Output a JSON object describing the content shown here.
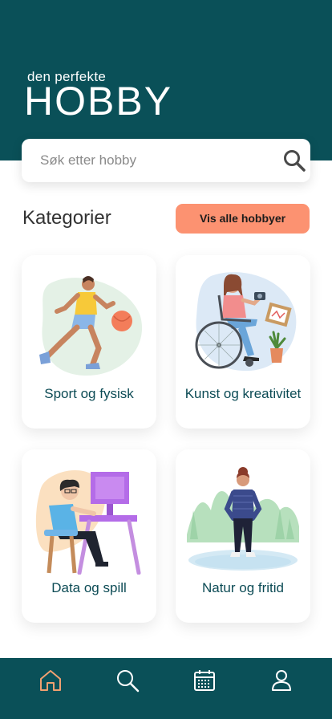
{
  "header": {
    "subtitle": "den perfekte",
    "title": "HOBBY"
  },
  "search": {
    "placeholder": "Søk etter hobby",
    "icon": "search-icon"
  },
  "categories": {
    "heading": "Kategorier",
    "view_all_label": "Vis alle hobbyer",
    "items": [
      {
        "label": "Sport og fysisk",
        "icon": "runner-illustration"
      },
      {
        "label": "Kunst og kreativitet",
        "icon": "artist-wheelchair-illustration"
      },
      {
        "label": "Data og spill",
        "icon": "computer-gamer-illustration"
      },
      {
        "label": "Natur og fritid",
        "icon": "nature-walker-illustration"
      }
    ]
  },
  "nav": {
    "items": [
      {
        "name": "home",
        "icon": "home-icon",
        "active": true
      },
      {
        "name": "search",
        "icon": "search-icon",
        "active": false
      },
      {
        "name": "calendar",
        "icon": "calendar-icon",
        "active": false
      },
      {
        "name": "profile",
        "icon": "profile-icon",
        "active": false
      }
    ]
  },
  "colors": {
    "primary": "#0a5058",
    "accent": "#fc9271",
    "active_nav": "#f0a070"
  }
}
